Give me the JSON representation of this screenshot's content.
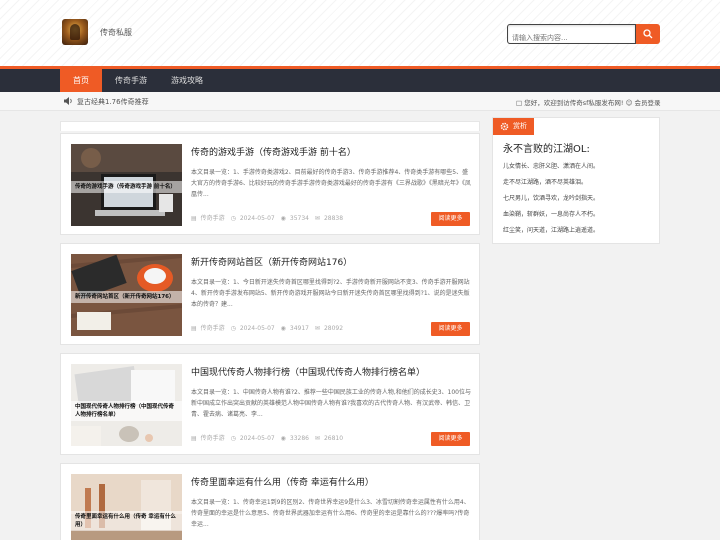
{
  "header": {
    "site_name": "传奇私服",
    "search_placeholder": "请输入搜索内容..."
  },
  "nav": {
    "items": [
      "首页",
      "传奇手游",
      "游戏攻略"
    ],
    "active_index": 0
  },
  "notice": {
    "ticker": "复古经典1.76传奇推荐",
    "greeting": "您好，欢迎到访传奇sf私服发布网!",
    "login": "会员登录"
  },
  "posts": [
    {
      "title": "传奇的游戏手游（传奇游戏手游 前十名）",
      "thumb_caption": "传奇的游戏手游（传奇游戏手游 前十名）",
      "excerpt": "本文目录一览：1、手游传奇类游戏2、目前最好的传奇手游3、传奇手游推荐4、传奇类手游有哪些5、盛大官方的传奇手游6、比较好玩的传奇手游手游传奇类游戏最好的传奇手游有《三界战歌》《黑暗光年》《凤凰传...",
      "category": "传奇手游",
      "date": "2024-05-07",
      "views": "35734",
      "comments": "28838",
      "more": "阅读更多"
    },
    {
      "title": "新开传奇网站首区（新开传奇网站176）",
      "thumb_caption": "新开传奇网站首区（新开传奇网站176）",
      "excerpt": "本文目录一览：1、今日新开迷失传奇首区哪里找得到?2、手游传奇新开服网站不变3、传奇手游开服网站4、新开传奇手游发布网站5、新开传奇游戏开服网站今日新开迷失传奇首区哪里找得到?1、说的是迷失版本的传奇？建...",
      "category": "传奇手游",
      "date": "2024-05-07",
      "views": "34917",
      "comments": "28092",
      "more": "阅读更多"
    },
    {
      "title": "中国现代传奇人物排行榜（中国现代传奇人物排行榜名单）",
      "thumb_caption": "中国现代传奇人物排行榜（中国现代传奇人物排行榜名单）",
      "excerpt": "本文目录一览：1、中国传奇人物有谁?2、推荐一些中国民族工业的传奇人物,和他们的成长史3、100位与新中国成立作出突出贡献的英雄模范人物中国传奇人物有谁?我喜欢的古代传奇人物、有汉武帝、韩信、卫青、霍去病、诸葛亮、李...",
      "category": "传奇手游",
      "date": "2024-05-07",
      "views": "33286",
      "comments": "26810",
      "more": "阅读更多"
    },
    {
      "title": "传奇里面幸运有什么用（传奇 幸运有什么用）",
      "thumb_caption": "传奇里面幸运有什么用（传奇 幸运有什么用）",
      "excerpt": "本文目录一览：1、传奇幸运1到9的区别2、传奇世界幸运9是什么3、冰雪切割传奇幸运属性有什么用4、传奇里面的幸运是什么意思5、传奇世界武器加幸运有什么用6、传奇里的幸运是靠什么的???爆率吗?传奇幸运...",
      "category": "",
      "date": "",
      "views": "",
      "comments": "",
      "more": ""
    }
  ],
  "sidebar": {
    "tag": "赏析",
    "title": "永不言败的江湖OL:",
    "lines": [
      "儿女情长、忠肝义胆、潇洒在人间。",
      "走不尽江湖路，酒不尽英雄泪。",
      "七尺男儿，饮酒寻欢，龙吟剑指天。",
      "血染鞘，斩群妖，一息尚存人不朽。",
      "红尘笑，问天道，江湖路上逍遥道。"
    ]
  },
  "colors": {
    "accent": "#ef5b25",
    "nav_bg": "#2b2f3a"
  }
}
